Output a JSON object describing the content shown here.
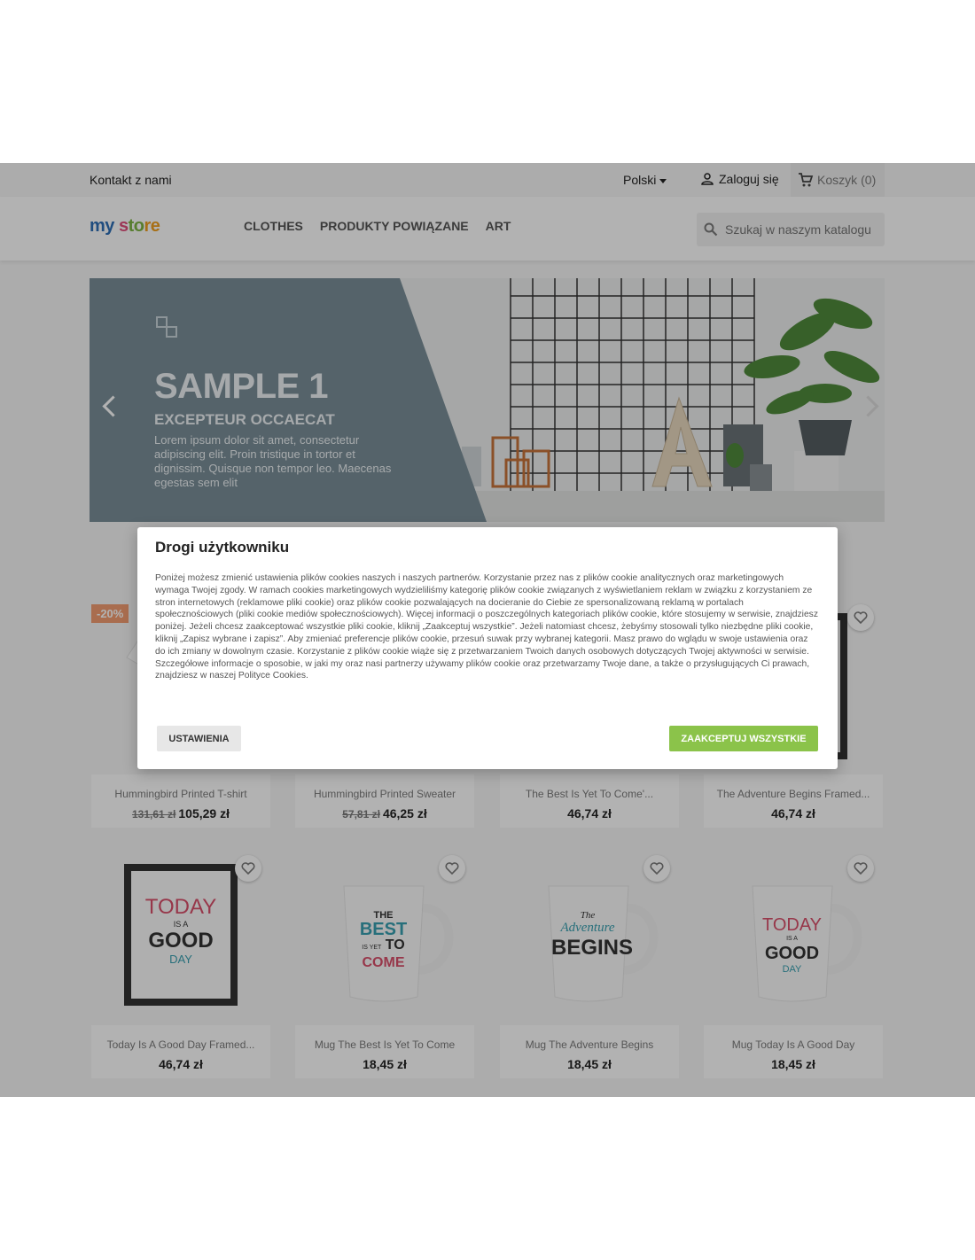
{
  "topbar": {
    "contact": "Kontakt z nami",
    "language": "Polski",
    "login": "Zaloguj się",
    "cart": "Koszyk",
    "cart_count": "(0)"
  },
  "header": {
    "logo": {
      "part1": "my ",
      "part2": "s",
      "part3": "to",
      "part4": "re"
    },
    "nav": [
      "CLOTHES",
      "PRODUKTY POWIĄZANE",
      "ART"
    ],
    "search_placeholder": "Szukaj w naszym katalogu"
  },
  "slider": {
    "title": "SAMPLE 1",
    "subtitle": "EXCEPTEUR OCCAECAT",
    "text": "Lorem ipsum dolor sit amet, consectetur adipiscing elit. Proin tristique in tortor et dignissim. Quisque non tempor leo. Maecenas egestas sem elit"
  },
  "products": [
    {
      "name": "Hummingbird Printed T-shirt",
      "old_price": "131,61 zł",
      "price": "105,29 zł",
      "badge": "-20%"
    },
    {
      "name": "Hummingbird Printed Sweater",
      "old_price": "57,81 zł",
      "price": "46,25 zł"
    },
    {
      "name": "The Best Is Yet To Come'...",
      "price": "46,74 zł"
    },
    {
      "name": "The Adventure Begins Framed...",
      "price": "46,74 zł"
    },
    {
      "name": "Today Is A Good Day Framed...",
      "price": "46,74 zł"
    },
    {
      "name": "Mug The Best Is Yet To Come",
      "price": "18,45 zł"
    },
    {
      "name": "Mug The Adventure Begins",
      "price": "18,45 zł"
    },
    {
      "name": "Mug Today Is A Good Day",
      "price": "18,45 zł"
    }
  ],
  "artwork": {
    "today_1": "TODAY",
    "today_2": "IS A",
    "today_3": "GOOD",
    "today_4": "DAY",
    "best_1": "THE",
    "best_2": "BEST",
    "best_3": "IS YET",
    "best_4": "TO",
    "best_5": "COME",
    "adv_1": "The",
    "adv_2": "Adventure",
    "adv_3": "BEGINS"
  },
  "cookie_modal": {
    "title": "Drogi użytkowniku",
    "text": "Poniżej możesz zmienić ustawienia plików cookies naszych i naszych partnerów. Korzystanie przez nas z plików cookie analitycznych oraz marketingowych wymaga Twojej zgody. W ramach cookies marketingowych wydzieliliśmy kategorię plików cookie związanych z wyświetlaniem reklam w związku z korzystaniem ze stron internetowych (reklamowe pliki cookie) oraz plików cookie pozwalających na docieranie do Ciebie ze spersonalizowaną reklamą w portalach społecznościowych (pliki cookie mediów społecznościowych). Więcej informacji o poszczególnych kategoriach plików cookie, które stosujemy w serwisie, znajdziesz poniżej. Jeżeli chcesz zaakceptować wszystkie pliki cookie, kliknij „Zaakceptuj wszystkie”. Jeżeli natomiast chcesz, żebyśmy stosowali tylko niezbędne pliki cookie, kliknij „Zapisz wybrane i zapisz”. Aby zmieniać preferencje plików cookie, przesuń suwak przy wybranej kategorii. Masz prawo do wglądu w swoje ustawienia oraz do ich zmiany w dowolnym czasie. Korzystanie z plików cookie wiąże się z przetwarzaniem Twoich danych osobowych dotyczących Twojej aktywności w serwisie. Szczegółowe informacje o sposobie, w jaki my oraz nasi partnerzy używamy plików cookie oraz przetwarzamy Twoje dane, a także o przysługujących Ci prawach, znajdziesz w naszej Polityce Cookies.",
    "settings_button": "USTAWIENIA",
    "accept_button": "ZAAKCEPTUJ WSZYSTKIE"
  },
  "colors": {
    "accept": "#8bc34a",
    "slide_panel": "#7a8f99",
    "badge": "#f39d72"
  }
}
